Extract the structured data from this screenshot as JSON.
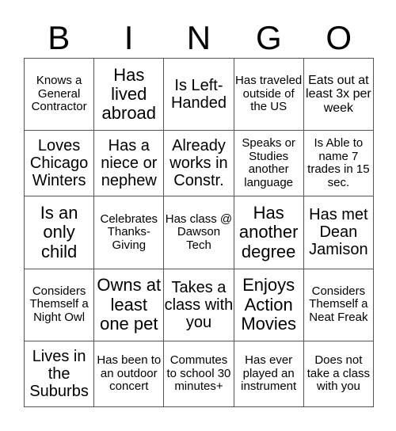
{
  "header": [
    "B",
    "I",
    "N",
    "G",
    "O"
  ],
  "rows": [
    [
      "Knows a General Contractor",
      "Has lived abroad",
      "Is Left-Handed",
      "Has traveled outside of the US",
      "Eats out at least 3x per week"
    ],
    [
      "Loves Chicago Winters",
      "Has a niece or nephew",
      "Already works in Constr.",
      "Speaks or Studies another language",
      "Is Able to name 7 trades in 15 sec."
    ],
    [
      "Is an only child",
      "Celebrates Thanks-Giving",
      "Has class @ Dawson Tech",
      "Has another degree",
      "Has met Dean Jamison"
    ],
    [
      "Considers Themself a Night Owl",
      "Owns at least one pet",
      "Takes a class with you",
      "Enjoys Action Movies",
      "Considers Themself a Neat Freak"
    ],
    [
      "Lives in the Suburbs",
      "Has been to an outdoor concert",
      "Commutes to school 30 minutes+",
      "Has ever played an instrument",
      "Does not take a class with you"
    ]
  ]
}
